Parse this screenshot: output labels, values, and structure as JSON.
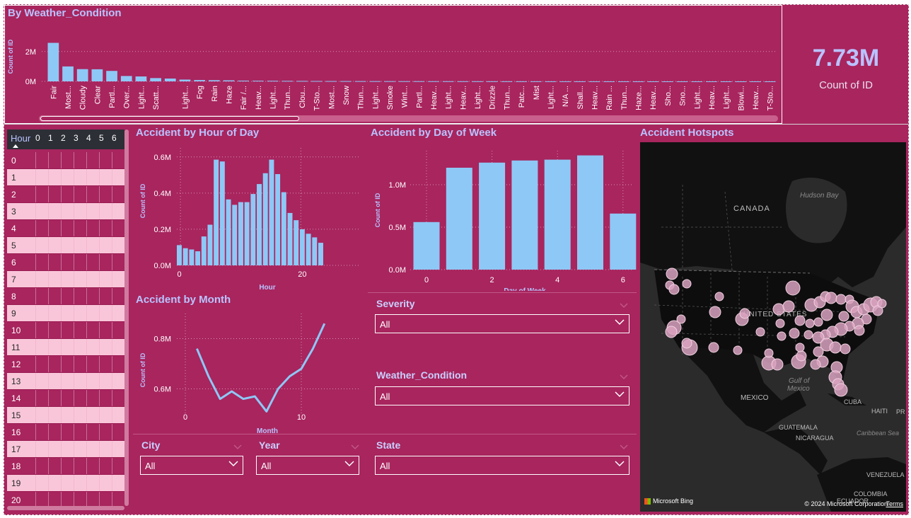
{
  "weather_chart": {
    "title": "By Weather_Condition",
    "ylabel": "Count of ID",
    "yticks": [
      "2M",
      "0M"
    ],
    "categories": [
      "Fair",
      "Most...",
      "Cloudy",
      "Clear",
      "Partl...",
      "Over...",
      "Light...",
      "Scatt...",
      "",
      "Light...",
      "Fog",
      "Rain",
      "Haze",
      "Fair /...",
      "Heav...",
      "Light...",
      "Thun...",
      "Clou...",
      "T-Sto...",
      "Most...",
      "Snow",
      "Thun...",
      "Light...",
      "Smoke",
      "Wint...",
      "Partl...",
      "Heav...",
      "Light...",
      "Heav...",
      "Light...",
      "Drizzle",
      "Thun...",
      "Patc...",
      "Mist",
      "Light...",
      "N/A ...",
      "Shall...",
      "Heav...",
      "Rain ...",
      "Thun...",
      "Haze...",
      "Heav...",
      "Sho...",
      "Sno...",
      "Light...",
      "Heav...",
      "Light...",
      "Blowi...",
      "Heav...",
      "T-Sto..."
    ]
  },
  "kpi": {
    "value": "7.73M",
    "label": "Count of ID"
  },
  "hour_table": {
    "header": "Hour",
    "columns": [
      "0",
      "1",
      "2",
      "3",
      "4",
      "5",
      "6"
    ],
    "rows": [
      "0",
      "1",
      "2",
      "3",
      "4",
      "5",
      "6",
      "7",
      "8",
      "9",
      "10",
      "11",
      "12",
      "13",
      "14",
      "15",
      "16",
      "17",
      "18",
      "19",
      "20"
    ]
  },
  "hour_chart": {
    "title": "Accident by Hour of Day",
    "xlabel": "Hour",
    "ylabel": "Count of ID",
    "yticks": [
      "0.6M",
      "0.4M",
      "0.2M",
      "0.0M"
    ],
    "xticks": [
      "0",
      "20"
    ]
  },
  "month_chart": {
    "title": "Accident by Month",
    "xlabel": "Month",
    "ylabel": "Count of ID",
    "yticks": [
      "0.8M",
      "0.6M"
    ],
    "xticks": [
      "0",
      "10"
    ]
  },
  "dow_chart": {
    "title": "Accident by Day of Week",
    "xlabel": "Day of Week",
    "ylabel": "Count of ID",
    "yticks": [
      "1.0M",
      "0.5M",
      "0.0M"
    ],
    "xticks": [
      "0",
      "2",
      "4",
      "6"
    ]
  },
  "slicers": {
    "severity": {
      "label": "Severity",
      "value": "All"
    },
    "weather": {
      "label": "Weather_Condition",
      "value": "All"
    },
    "city": {
      "label": "City",
      "value": "All"
    },
    "year": {
      "label": "Year",
      "value": "All"
    },
    "state": {
      "label": "State",
      "value": "All"
    }
  },
  "map": {
    "title": "Accident Hotspots",
    "labels": {
      "canada": "CANADA",
      "hudson": "Hudson Bay",
      "us": "UNITED STATES",
      "gulf1": "Gulf of",
      "gulf2": "Mexico",
      "mexico": "MEXICO",
      "cuba": "CUBA",
      "haiti": "HAITI",
      "pr": "PR",
      "guatemala": "GUATEMALA",
      "nicaragua": "NICARAGUA",
      "caribbean": "Caribbean Sea",
      "venezuela": "VENEZUELA",
      "colombia": "COLOMBIA",
      "ecuador": "ECUADOR"
    },
    "bing": "Microsoft Bing",
    "copyright": "© 2024 Microsoft Corporation",
    "terms": "Terms"
  },
  "colors": {
    "background": "#a8255e",
    "bar": "#8ec8f6",
    "accent_text": "#b9c3ff",
    "map_dot": "#d9a2c0"
  },
  "chart_data": [
    {
      "type": "bar",
      "title": "By Weather_Condition",
      "ylabel": "Count of ID",
      "ylim": [
        0,
        2700000
      ],
      "categories": [
        "Fair",
        "Most...",
        "Cloudy",
        "Clear",
        "Partl...",
        "Over...",
        "Light...",
        "Scatt...",
        "",
        "Light...",
        "Fog",
        "Rain",
        "Haze",
        "Fair /...",
        "Heav...",
        "Light...",
        "Thun...",
        "Clou...",
        "T-Sto...",
        "Most...",
        "Snow",
        "Thun...",
        "Light...",
        "Smoke",
        "Wint...",
        "Partl...",
        "Heav...",
        "Light...",
        "Heav...",
        "Light...",
        "Drizzle",
        "Thun...",
        "Patc...",
        "Mist",
        "Light...",
        "N/A ...",
        "Shall...",
        "Heav...",
        "Rain ...",
        "Thun...",
        "Haze...",
        "Heav...",
        "Sho...",
        "Sno...",
        "Light...",
        "Heav...",
        "Light...",
        "Blowi...",
        "Heav...",
        "T-Sto..."
      ],
      "values": [
        2580000,
        1000000,
        820000,
        810000,
        700000,
        360000,
        330000,
        220000,
        190000,
        120000,
        90000,
        80000,
        70000,
        50000,
        45000,
        40000,
        35000,
        30000,
        25000,
        22000,
        20000,
        18000,
        16000,
        15000,
        14000,
        13000,
        12000,
        11000,
        10000,
        9000,
        8000,
        7000,
        6000,
        6000,
        5000,
        5000,
        4000,
        4000,
        3000,
        3000,
        3000,
        2000,
        2000,
        2000,
        2000,
        1000,
        1000,
        1000,
        1000,
        1000
      ]
    },
    {
      "type": "bar",
      "title": "Accident by Hour of Day",
      "xlabel": "Hour",
      "ylabel": "Count of ID",
      "ylim": [
        0,
        650000
      ],
      "x": [
        0,
        1,
        2,
        3,
        4,
        5,
        6,
        7,
        8,
        9,
        10,
        11,
        12,
        13,
        14,
        15,
        16,
        17,
        18,
        19,
        20,
        21,
        22,
        23
      ],
      "values": [
        112000,
        95000,
        88000,
        78000,
        160000,
        225000,
        585000,
        575000,
        365000,
        335000,
        350000,
        350000,
        395000,
        450000,
        510000,
        585000,
        505000,
        405000,
        290000,
        250000,
        200000,
        175000,
        155000,
        125000
      ]
    },
    {
      "type": "line",
      "title": "Accident by Month",
      "xlabel": "Month",
      "ylabel": "Count of ID",
      "ylim": [
        500000,
        900000
      ],
      "x": [
        1,
        2,
        3,
        4,
        5,
        6,
        7,
        8,
        9,
        10,
        11,
        12
      ],
      "values": [
        760000,
        650000,
        560000,
        590000,
        560000,
        570000,
        510000,
        600000,
        650000,
        680000,
        760000,
        860000
      ]
    },
    {
      "type": "bar",
      "title": "Accident by Day of Week",
      "xlabel": "Day of Week",
      "ylabel": "Count of ID",
      "ylim": [
        0,
        1400000
      ],
      "x": [
        0,
        1,
        2,
        3,
        4,
        5,
        6
      ],
      "values": [
        560000,
        1200000,
        1260000,
        1285000,
        1295000,
        1345000,
        660000
      ]
    }
  ]
}
